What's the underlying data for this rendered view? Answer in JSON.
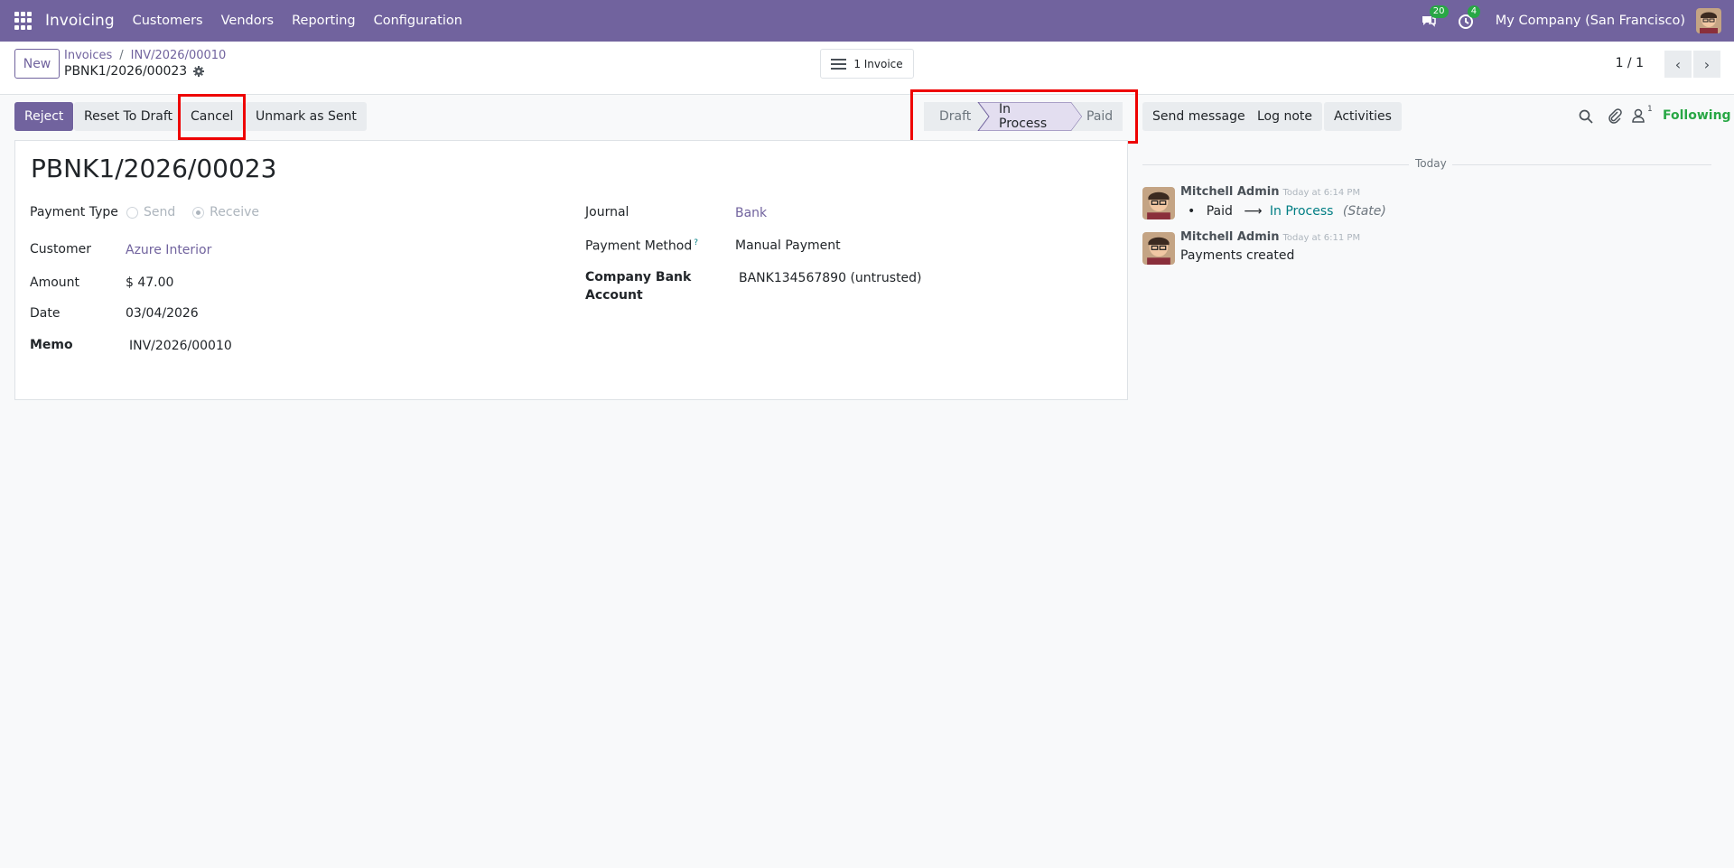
{
  "nav": {
    "app_name": "Invoicing",
    "menu": [
      "Customers",
      "Vendors",
      "Reporting",
      "Configuration"
    ],
    "messages_count": "20",
    "activities_count": "4",
    "company": "My Company (San Francisco)",
    "accent_color": "#71639e"
  },
  "control_panel": {
    "new_label": "New",
    "breadcrumb": [
      "Invoices",
      "INV/2026/00010"
    ],
    "breadcrumb_sep": "/",
    "current_record": "PBNK1/2026/00023",
    "smart_button_label": "1 Invoice",
    "pager": "1 / 1",
    "pager_prev": "‹",
    "pager_next": "›"
  },
  "actions": {
    "reject": "Reject",
    "reset_to_draft": "Reset To Draft",
    "cancel": "Cancel",
    "unmark_as_sent": "Unmark as Sent"
  },
  "status": {
    "stages": [
      "Draft",
      "In Process",
      "Paid"
    ],
    "current": "In Process"
  },
  "form": {
    "title": "PBNK1/2026/00023",
    "payment_type_label": "Payment Type",
    "payment_type_options": [
      "Send",
      "Receive"
    ],
    "payment_type_selected": "Receive",
    "customer_label": "Customer",
    "customer_value": "Azure Interior",
    "amount_label": "Amount",
    "amount_value": "$ 47.00",
    "date_label": "Date",
    "date_value": "03/04/2026",
    "memo_label": "Memo",
    "memo_value": "INV/2026/00010",
    "journal_label": "Journal",
    "journal_value": "Bank",
    "payment_method_label": "Payment Method",
    "payment_method_help": "?",
    "payment_method_value": "Manual Payment",
    "company_bank_label_1": "Company Bank",
    "company_bank_label_2": "Account",
    "company_bank_value": "BANK134567890 (untrusted)"
  },
  "chatter": {
    "send_message": "Send message",
    "log_note": "Log note",
    "activities": "Activities",
    "followers_count": "1",
    "following": "Following",
    "date_separator": "Today",
    "messages": [
      {
        "author": "Mitchell Admin",
        "time": "Today at 6:14 PM",
        "old_value": "Paid",
        "arrow": "⟶",
        "new_value": "In Process",
        "field": "(State)"
      },
      {
        "author": "Mitchell Admin",
        "time": "Today at 6:11 PM",
        "body": "Payments created"
      }
    ]
  }
}
